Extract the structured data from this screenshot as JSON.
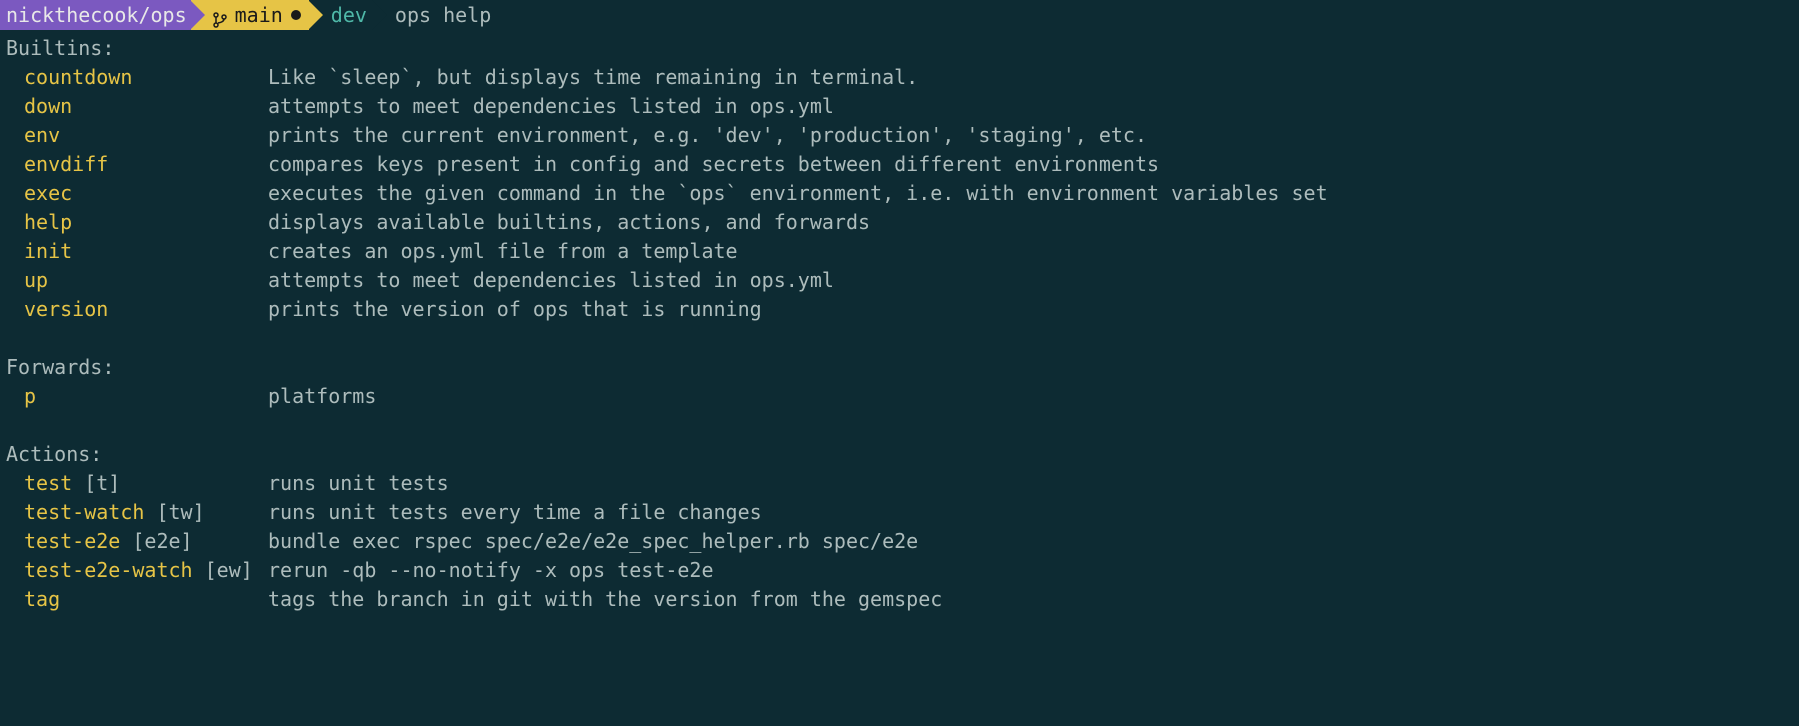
{
  "prompt": {
    "path": "nickthecook/ops",
    "branch": "main",
    "env": "dev",
    "command": "ops help"
  },
  "sections": [
    {
      "title": "Builtins:",
      "items": [
        {
          "name": "countdown",
          "alias": "",
          "desc": "Like `sleep`, but displays time remaining in terminal."
        },
        {
          "name": "down",
          "alias": "",
          "desc": "attempts to meet dependencies listed in ops.yml"
        },
        {
          "name": "env",
          "alias": "",
          "desc": "prints the current environment, e.g. 'dev', 'production', 'staging', etc."
        },
        {
          "name": "envdiff",
          "alias": "",
          "desc": "compares keys present in config and secrets between different environments"
        },
        {
          "name": "exec",
          "alias": "",
          "desc": "executes the given command in the `ops` environment, i.e. with environment variables set"
        },
        {
          "name": "help",
          "alias": "",
          "desc": "displays available builtins, actions, and forwards"
        },
        {
          "name": "init",
          "alias": "",
          "desc": "creates an ops.yml file from a template"
        },
        {
          "name": "up",
          "alias": "",
          "desc": "attempts to meet dependencies listed in ops.yml"
        },
        {
          "name": "version",
          "alias": "",
          "desc": "prints the version of ops that is running"
        }
      ]
    },
    {
      "title": "Forwards:",
      "items": [
        {
          "name": "p",
          "alias": "",
          "desc": "platforms"
        }
      ]
    },
    {
      "title": "Actions:",
      "items": [
        {
          "name": "test",
          "alias": " [t]",
          "desc": "runs unit tests"
        },
        {
          "name": "test-watch",
          "alias": " [tw]",
          "desc": "runs unit tests every time a file changes"
        },
        {
          "name": "test-e2e",
          "alias": " [e2e]",
          "desc": "bundle exec rspec spec/e2e/e2e_spec_helper.rb spec/e2e"
        },
        {
          "name": "test-e2e-watch",
          "alias": " [ew]",
          "desc": "rerun -qb --no-notify -x ops test-e2e"
        },
        {
          "name": "tag",
          "alias": "",
          "desc": "tags the branch in git with the version from the gemspec"
        }
      ]
    }
  ]
}
